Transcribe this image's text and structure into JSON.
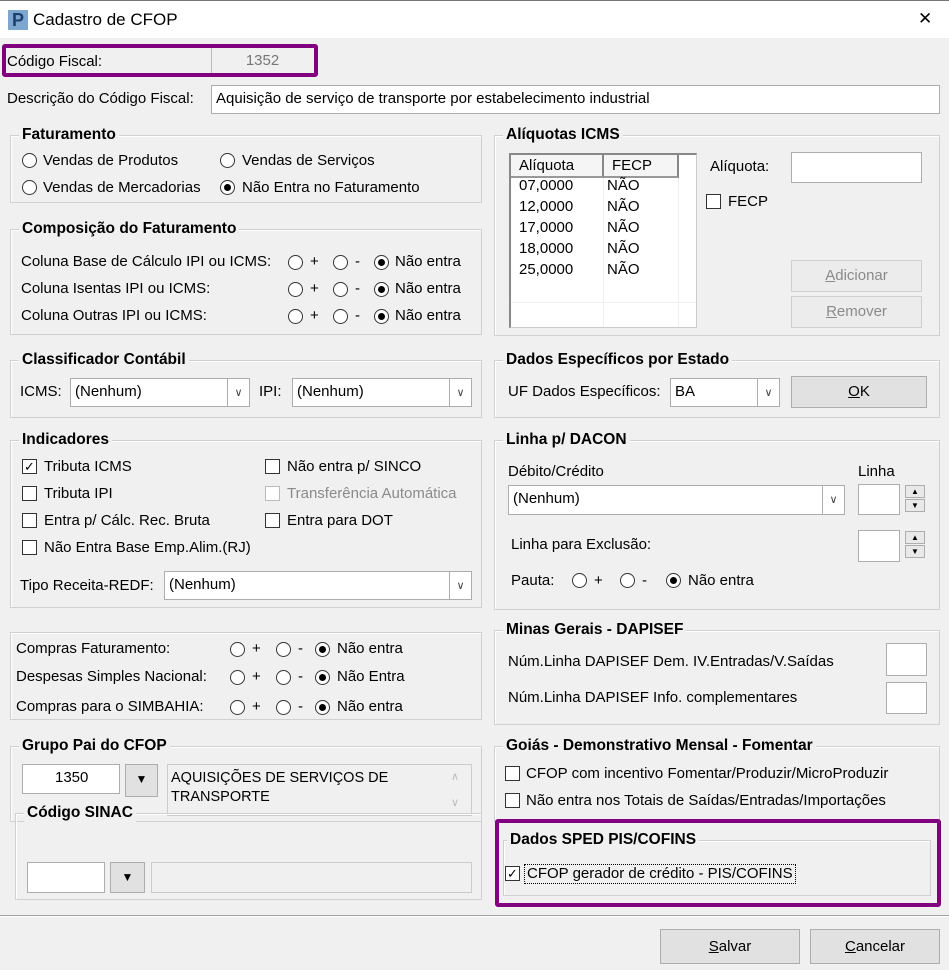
{
  "window": {
    "title": "Cadastro de CFOP",
    "close": "✕",
    "icon": "app-logo-icon"
  },
  "codigo": {
    "label": "Código Fiscal:",
    "value": "1352"
  },
  "descricao": {
    "label": "Descrição do Código Fiscal:",
    "value": "Aquisição de serviço de transporte por estabelecimento industrial"
  },
  "faturamento": {
    "title": "Faturamento",
    "options": [
      "Vendas de Produtos",
      "Vendas de Serviços",
      "Vendas de Mercadorias",
      "Não Entra no Faturamento"
    ],
    "selected": "Não Entra no Faturamento"
  },
  "composicao": {
    "title": "Composição do Faturamento",
    "rows": [
      {
        "label": "Coluna Base de Cálculo IPI ou ICMS:",
        "plus": "+",
        "minus": "-",
        "none": "Não entra"
      },
      {
        "label": "Coluna Isentas IPI ou ICMS:",
        "plus": "+",
        "minus": "-",
        "none": "Não entra"
      },
      {
        "label": "Coluna Outras IPI ou ICMS:",
        "plus": "+",
        "minus": "-",
        "none": "Não entra"
      }
    ]
  },
  "classificador": {
    "title": "Classificador Contábil",
    "icms_label": "ICMS:",
    "icms_value": "(Nenhum)",
    "ipi_label": "IPI:",
    "ipi_value": "(Nenhum)"
  },
  "indicadores": {
    "title": "Indicadores",
    "items": [
      {
        "label": "Tributa ICMS",
        "checked": true
      },
      {
        "label": "Tributa IPI",
        "checked": false
      },
      {
        "label": "Entra p/ Cálc. Rec. Bruta",
        "checked": false
      },
      {
        "label": "Não Entra Base Emp.Alim.(RJ)",
        "checked": false
      },
      {
        "label": "Não entra p/ SINCO",
        "checked": false
      },
      {
        "label": "Transferência Automática",
        "checked": false,
        "disabled": true
      },
      {
        "label": "Entra para DOT",
        "checked": false
      }
    ],
    "tipo_receita_label": "Tipo Receita-REDF:",
    "tipo_receita_value": "(Nenhum)"
  },
  "compras": {
    "rows": [
      {
        "label": "Compras Faturamento:",
        "plus": "+",
        "minus": "-",
        "none": "Não entra"
      },
      {
        "label": "Despesas Simples Nacional:",
        "plus": "+",
        "minus": "-",
        "none": "Não Entra"
      },
      {
        "label": "Compras para o SIMBAHIA:",
        "plus": "+",
        "minus": "-",
        "none": "Não entra"
      }
    ]
  },
  "grupo_pai": {
    "title": "Grupo Pai do CFOP",
    "code": "1350",
    "description": "AQUISIÇÕES DE SERVIÇOS DE TRANSPORTE"
  },
  "sinac": {
    "title": "Código SINAC",
    "code": "",
    "description": ""
  },
  "aliquotas": {
    "title": "Alíquotas ICMS",
    "columns": [
      "Alíquota",
      "FECP"
    ],
    "rows": [
      [
        "07,0000",
        "NÃO"
      ],
      [
        "12,0000",
        "NÃO"
      ],
      [
        "17,0000",
        "NÃO"
      ],
      [
        "18,0000",
        "NÃO"
      ],
      [
        "25,0000",
        "NÃO"
      ]
    ],
    "aliquota_label": "Alíquota:",
    "aliquota_value": "",
    "fecp_label": "FECP",
    "add": "Adicionar",
    "remove": "Remover"
  },
  "estado": {
    "title": "Dados Específicos por Estado",
    "uf_label": "UF Dados Específicos:",
    "uf_value": "BA",
    "ok": "OK"
  },
  "dacon": {
    "title": "Linha p/ DACON",
    "debito_label": "Débito/Crédito",
    "debito_value": "(Nenhum)",
    "linha_label": "Linha",
    "exclusao_label": "Linha para Exclusão:",
    "pauta_label": "Pauta:",
    "plus": "+",
    "minus": "-",
    "none": "Não entra"
  },
  "minas": {
    "title": "Minas Gerais - DAPISEF",
    "row1": "Núm.Linha DAPISEF Dem. IV.Entradas/V.Saídas",
    "row2": "Núm.Linha DAPISEF Info. complementares"
  },
  "goias": {
    "title": "Goiás - Demonstrativo Mensal - Fomentar",
    "items": [
      "CFOP com incentivo  Fomentar/Produzir/MicroProduzir",
      "Não entra nos Totais de  Saídas/Entradas/Importações"
    ]
  },
  "sped": {
    "title": "Dados SPED PIS/COFINS",
    "label": "CFOP gerador de crédito - PIS/COFINS",
    "checked": true
  },
  "footer": {
    "save": "Salvar",
    "cancel": "Cancelar"
  },
  "colors": {
    "highlight": "#800080",
    "background": "#f0f0f0"
  }
}
